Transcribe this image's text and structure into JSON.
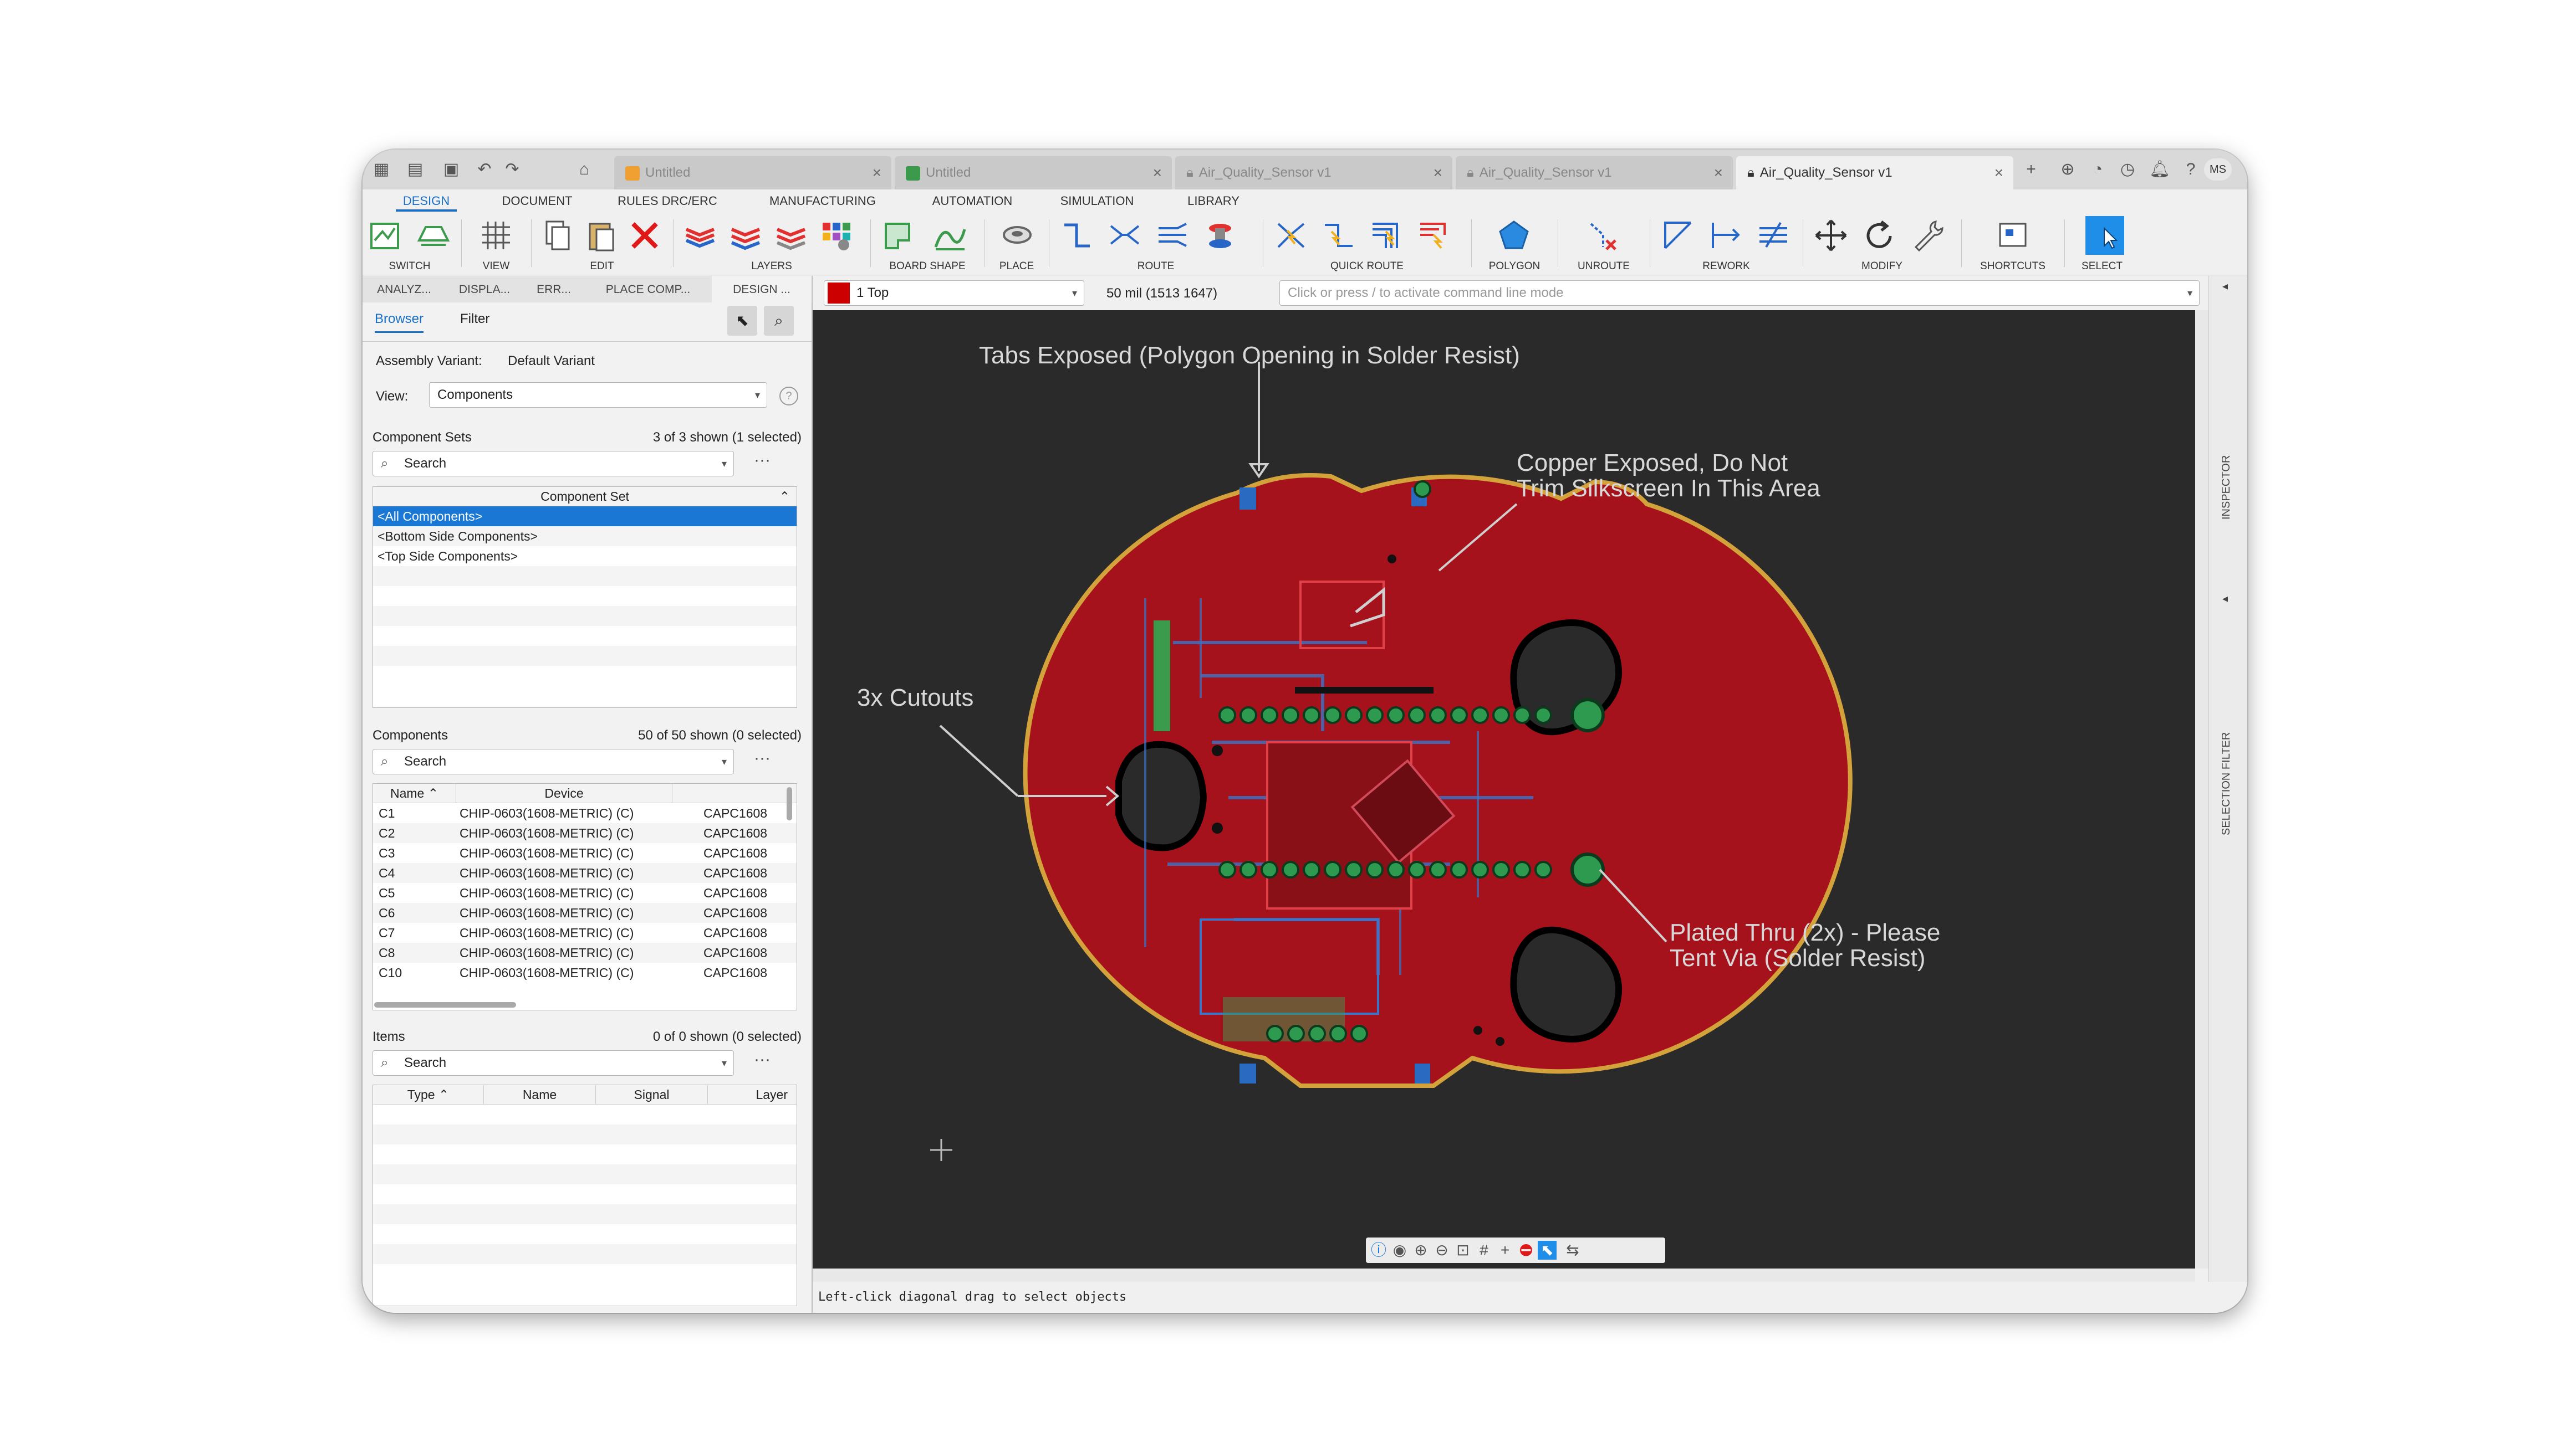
{
  "titlebar": {
    "tabs": [
      {
        "label": "Untitled",
        "icon": "box-icon",
        "active": false
      },
      {
        "label": "Untitled",
        "icon": "schematic-icon",
        "active": false
      },
      {
        "label": "Air_Quality_Sensor v1",
        "icon": "lock-icon",
        "active": false
      },
      {
        "label": "Air_Quality_Sensor v1",
        "icon": "lock-icon",
        "active": false
      },
      {
        "label": "Air_Quality_Sensor v1",
        "icon": "lock-icon",
        "active": true
      }
    ],
    "user_initials": "MS"
  },
  "ribbon_tabs": [
    "DESIGN",
    "DOCUMENT",
    "RULES DRC/ERC",
    "MANUFACTURING",
    "AUTOMATION",
    "SIMULATION",
    "LIBRARY"
  ],
  "ribbon_groups": [
    "SWITCH",
    "VIEW",
    "EDIT",
    "LAYERS",
    "BOARD SHAPE",
    "PLACE",
    "ROUTE",
    "QUICK ROUTE",
    "POLYGON",
    "UNROUTE",
    "REWORK",
    "MODIFY",
    "SHORTCUTS",
    "SELECT"
  ],
  "panel": {
    "subtabs": [
      "ANALYZ...",
      "DISPLA...",
      "ERR...",
      "PLACE COMP...",
      "DESIGN ..."
    ],
    "browser_tab": "Browser",
    "filter_tab": "Filter",
    "assembly_variant_label": "Assembly Variant:",
    "assembly_variant_value": "Default Variant",
    "view_label": "View:",
    "view_value": "Components",
    "component_sets_title": "Component Sets",
    "component_sets_count": "3 of 3 shown (1 selected)",
    "search_placeholder": "Search",
    "component_set_header": "Component Set",
    "component_sets": [
      "<All Components>",
      "<Bottom Side Components>",
      "<Top Side Components>"
    ],
    "components_title": "Components",
    "components_count": "50 of 50 shown (0 selected)",
    "components_headers": {
      "name": "Name",
      "device": "Device"
    },
    "components": [
      {
        "name": "C1",
        "device": "CHIP-0603(1608-METRIC) (C)",
        "pkg": "CAPC1608"
      },
      {
        "name": "C2",
        "device": "CHIP-0603(1608-METRIC) (C)",
        "pkg": "CAPC1608"
      },
      {
        "name": "C3",
        "device": "CHIP-0603(1608-METRIC) (C)",
        "pkg": "CAPC1608"
      },
      {
        "name": "C4",
        "device": "CHIP-0603(1608-METRIC) (C)",
        "pkg": "CAPC1608"
      },
      {
        "name": "C5",
        "device": "CHIP-0603(1608-METRIC) (C)",
        "pkg": "CAPC1608"
      },
      {
        "name": "C6",
        "device": "CHIP-0603(1608-METRIC) (C)",
        "pkg": "CAPC1608"
      },
      {
        "name": "C7",
        "device": "CHIP-0603(1608-METRIC) (C)",
        "pkg": "CAPC1608"
      },
      {
        "name": "C8",
        "device": "CHIP-0603(1608-METRIC) (C)",
        "pkg": "CAPC1608"
      },
      {
        "name": "C10",
        "device": "CHIP-0603(1608-METRIC) (C)",
        "pkg": "CAPC1608"
      }
    ],
    "items_title": "Items",
    "items_count": "0 of 0 shown (0 selected)",
    "items_headers": {
      "type": "Type",
      "name": "Name",
      "signal": "Signal",
      "layer": "Layer"
    }
  },
  "layerbar": {
    "layer": "1 Top",
    "layer_color": "#cc0000",
    "grid": "50 mil (1513 1647)",
    "command_placeholder": "Click or press / to activate command line mode"
  },
  "right_panels": [
    "INSPECTOR",
    "SELECTION FILTER"
  ],
  "annotations": {
    "tabs": "Tabs Exposed (Polygon Opening in Solder Resist)",
    "copper_1": "Copper Exposed, Do Not",
    "copper_2": "Trim Silkscreen In This Area",
    "cutouts": "3x Cutouts",
    "plated_1": "Plated Thru (2x) - Please",
    "plated_2": "Tent Via (Solder Resist)"
  },
  "status": "Left-click diagonal drag to select objects",
  "colors": {
    "accent": "#1a78d4",
    "board": "#b3141e",
    "canvas": "#2a2a2a",
    "outline": "#d4a23a"
  }
}
